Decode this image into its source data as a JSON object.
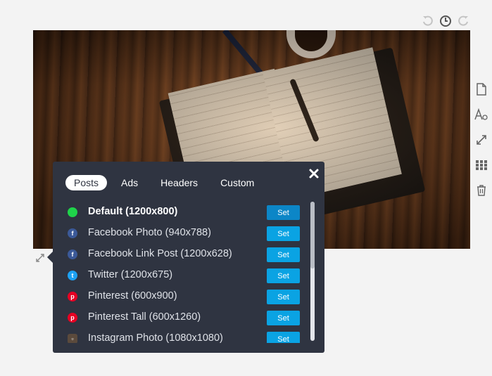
{
  "toolbar": {
    "undo_icon": "undo-icon",
    "history_icon": "clock-icon",
    "redo_icon": "redo-icon"
  },
  "sidebar": {
    "icons": [
      "page-icon",
      "text-style-icon",
      "resize-icon",
      "grid-icon",
      "trash-icon"
    ]
  },
  "panel": {
    "tabs": [
      {
        "label": "Posts",
        "active": true
      },
      {
        "label": "Ads",
        "active": false
      },
      {
        "label": "Headers",
        "active": false
      },
      {
        "label": "Custom",
        "active": false
      }
    ],
    "set_label": "Set",
    "items": [
      {
        "label": "Default (1200x800)",
        "icon": "green-dot-icon",
        "color": "#1fd34a",
        "glyph": "",
        "bold": true
      },
      {
        "label": "Facebook Photo (940x788)",
        "icon": "facebook-icon",
        "color": "#3b5998",
        "glyph": "f"
      },
      {
        "label": "Facebook Link Post (1200x628)",
        "icon": "facebook-icon",
        "color": "#3b5998",
        "glyph": "f"
      },
      {
        "label": "Twitter (1200x675)",
        "icon": "twitter-icon",
        "color": "#1da1f2",
        "glyph": "t"
      },
      {
        "label": "Pinterest (600x900)",
        "icon": "pinterest-icon",
        "color": "#e60023",
        "glyph": "p"
      },
      {
        "label": "Pinterest Tall (600x1260)",
        "icon": "pinterest-icon",
        "color": "#e60023",
        "glyph": "p"
      },
      {
        "label": "Instagram Photo (1080x1080)",
        "icon": "instagram-icon",
        "color": "#5b4a3c",
        "glyph": "▫"
      }
    ]
  },
  "colors": {
    "panel_bg": "#2f3441",
    "set_button": "#0aa3e3",
    "page_bg": "#f3f3f3"
  }
}
